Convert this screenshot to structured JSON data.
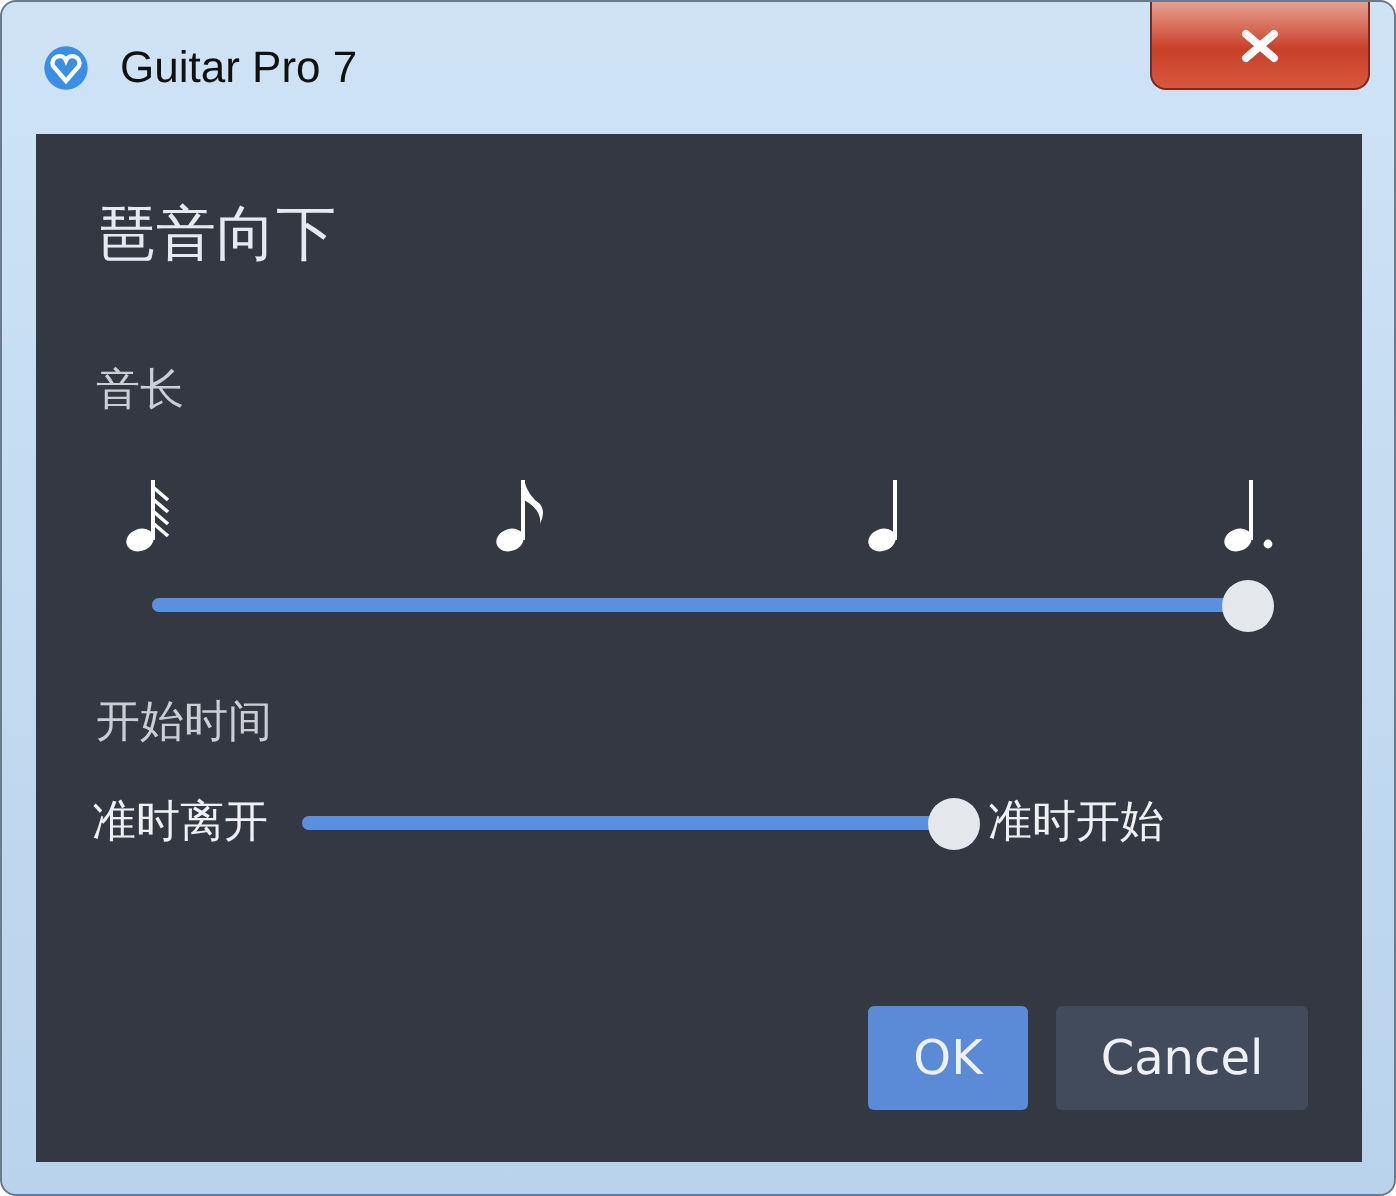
{
  "window": {
    "title": "Guitar Pro 7"
  },
  "dialog": {
    "title": "琶音向下",
    "duration": {
      "label": "音长",
      "notes": [
        {
          "kind": "thirty-second"
        },
        {
          "kind": "eighth"
        },
        {
          "kind": "quarter"
        },
        {
          "kind": "dotted-quarter"
        }
      ],
      "level": 1
    },
    "start_time": {
      "label": "开始时间",
      "left_label": "准时离开",
      "right_label": "准时开始",
      "level": 1
    },
    "buttons": [
      {
        "label": "OK",
        "kind": "primary"
      },
      {
        "label": "Cancel",
        "kind": "secondary"
      }
    ]
  }
}
